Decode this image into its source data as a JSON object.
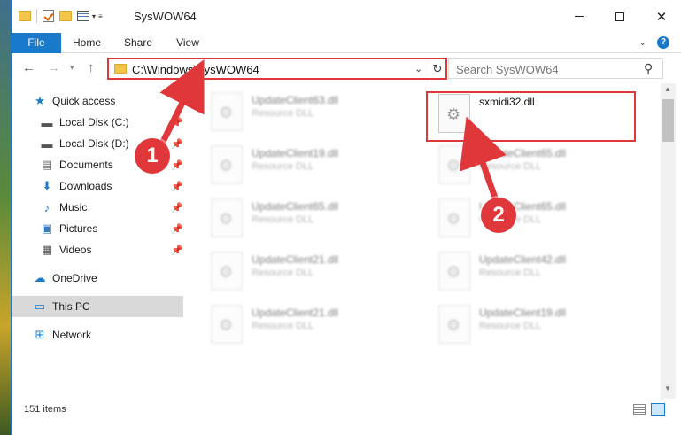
{
  "window": {
    "title": "SysWOW64",
    "qat_icons": [
      "folder-icon",
      "properties-check-icon",
      "new-folder-icon",
      "properties-icon"
    ]
  },
  "ribbon": {
    "tabs": [
      {
        "label": "File"
      },
      {
        "label": "Home"
      },
      {
        "label": "Share"
      },
      {
        "label": "View"
      }
    ],
    "help": "?"
  },
  "address_bar": {
    "path": "C:\\Windows\\SysWOW64",
    "refresh_glyph": "↻"
  },
  "search": {
    "placeholder": "Search SysWOW64"
  },
  "sidebar": {
    "items": [
      {
        "label": "Quick access",
        "icon": "star-icon"
      },
      {
        "label": "Local Disk (C:)",
        "icon": "drive-icon"
      },
      {
        "label": "Local Disk (D:)",
        "icon": "drive-icon"
      },
      {
        "label": "Documents",
        "icon": "documents-icon"
      },
      {
        "label": "Downloads",
        "icon": "download-icon"
      },
      {
        "label": "Music",
        "icon": "music-icon"
      },
      {
        "label": "Pictures",
        "icon": "pictures-icon"
      },
      {
        "label": "Videos",
        "icon": "videos-icon"
      },
      {
        "label": "OneDrive",
        "icon": "cloud-icon"
      },
      {
        "label": "This PC",
        "icon": "computer-icon"
      },
      {
        "label": "Network",
        "icon": "network-icon"
      }
    ]
  },
  "files": {
    "left_column": [
      {
        "name": "UpdateClient63.dll",
        "type": "Resource DLL"
      },
      {
        "name": "UpdateClient19.dll",
        "type": "Resource DLL"
      },
      {
        "name": "UpdateClient65.dll",
        "type": "Resource DLL"
      },
      {
        "name": "UpdateClient21.dll",
        "type": "Resource DLL"
      },
      {
        "name": "UpdateClient21.dll",
        "type": "Resource DLL"
      }
    ],
    "right_column": [
      {
        "name": "sxmidi32.dll",
        "type": ""
      },
      {
        "name": "UpdateClient65.dll",
        "type": "Resource DLL"
      },
      {
        "name": "UpdateClient65.dll",
        "type": "Resource DLL"
      },
      {
        "name": "UpdateClient42.dll",
        "type": "Resource DLL"
      },
      {
        "name": "UpdateClient19.dll",
        "type": "Resource DLL"
      }
    ]
  },
  "status": {
    "item_count": "151 items"
  },
  "callouts": {
    "one": "1",
    "two": "2",
    "color": "#e0373b"
  },
  "colors": {
    "accent": "#1979ca",
    "highlight_red": "#e0373b",
    "selected_bg": "#cce8ff"
  }
}
